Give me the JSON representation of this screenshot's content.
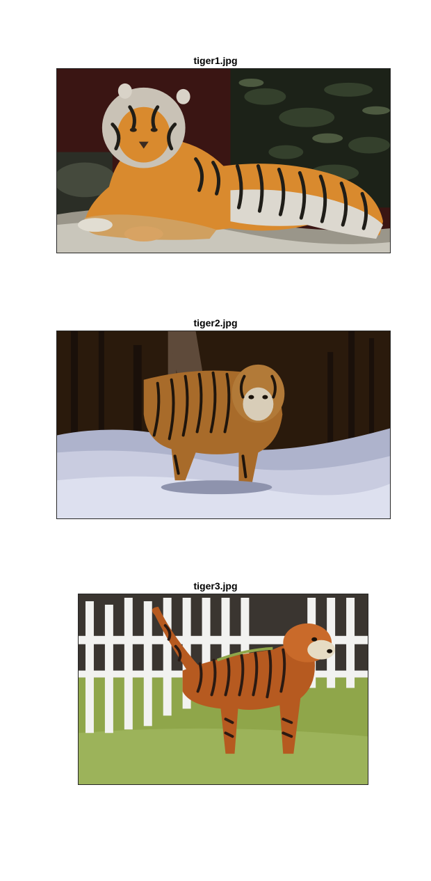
{
  "figure": {
    "panels": [
      {
        "title": "tiger1.jpg",
        "scene": "tiger lying on a rock in front of bamboo foliage"
      },
      {
        "title": "tiger2.jpg",
        "scene": "tiger walking through snow in a dark forest"
      },
      {
        "title": "tiger3.jpg",
        "scene": "dog painted with tiger stripes standing on grass by a white picket fence"
      }
    ]
  },
  "colors": {
    "background": "#ffffff",
    "frame": "#262626",
    "tiger_orange": "#d98a2e",
    "stripe_dark": "#1f1d18",
    "snow": "#c9cce0",
    "grass": "#8fa64a",
    "fence_white": "#f2f2f0"
  }
}
